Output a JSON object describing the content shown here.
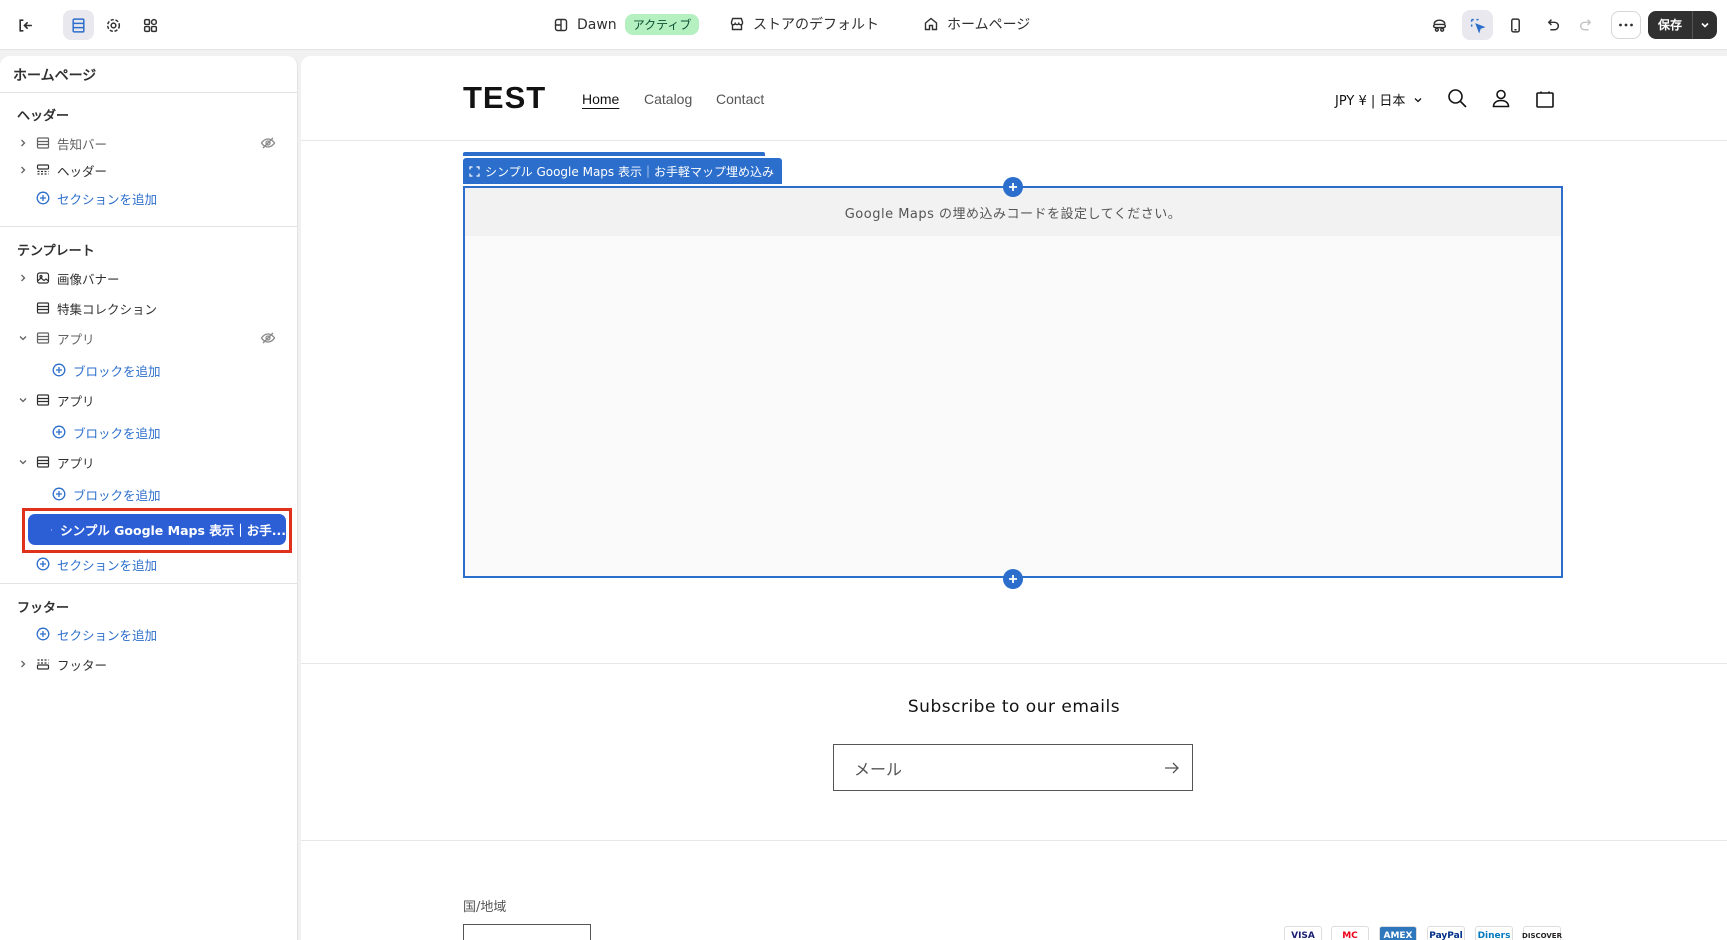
{
  "topbar": {
    "theme_name": "Dawn",
    "theme_badge": "アクティブ",
    "store_default": "ストアのデフォルト",
    "page": "ホームページ",
    "save_label": "保存",
    "icons": [
      "exit-icon",
      "sections-icon",
      "settings-icon",
      "apps-icon",
      "theme-icon",
      "store-icon",
      "home-icon",
      "inspector-icon",
      "select-icon",
      "mobile-icon",
      "undo-icon",
      "redo-icon",
      "more-icon",
      "chevron-down-icon"
    ]
  },
  "sidebar": {
    "title": "ホームページ",
    "header_group": "ヘッダー",
    "header_items": [
      "告知バー",
      "ヘッダー"
    ],
    "add_section": "セクションを追加",
    "template_group": "テンプレート",
    "template_items": {
      "image_banner": "画像バナー",
      "featured_collection": "特集コレクション",
      "app1": "アプリ",
      "app2": "アプリ",
      "app3": "アプリ",
      "add_block": "ブロックを追加",
      "selected": "シンプル Google Maps 表示｜お手..."
    },
    "footer_group": "フッター",
    "footer_item": "フッター"
  },
  "preview": {
    "logo": "TEST",
    "nav": [
      "Home",
      "Catalog",
      "Contact"
    ],
    "currency": "JPY ¥ | 日本",
    "section_tag": "シンプル Google Maps 表示｜お手軽マップ埋め込み",
    "map_message": "Google Maps の埋め込みコードを設定してください。",
    "subscribe_title": "Subscribe to our emails",
    "email_placeholder": "メール",
    "region_label": "国/地域",
    "payments": [
      "VISA",
      "MC",
      "AMEX",
      "PayPal",
      "Diners",
      "DISCOVER"
    ]
  },
  "colors": {
    "accent": "#2c6ecb",
    "selected": "#2c5fd6",
    "highlight_border": "#e0311b",
    "save_bg": "#303030",
    "badge_bg": "#b4f0c0"
  }
}
